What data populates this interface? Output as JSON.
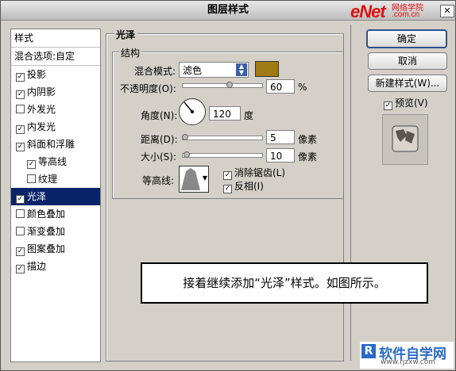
{
  "window": {
    "title": "图层样式"
  },
  "watermark": {
    "brand": "eNet",
    "cn": "网络学院",
    "url": ".com.cn"
  },
  "sidebar": {
    "header": "样式",
    "blend_options": "混合选项:自定",
    "items": [
      {
        "label": "投影",
        "checked": true
      },
      {
        "label": "内阴影",
        "checked": true
      },
      {
        "label": "外发光",
        "checked": false
      },
      {
        "label": "内发光",
        "checked": true
      },
      {
        "label": "斜面和浮雕",
        "checked": true
      },
      {
        "label": "等高线",
        "checked": true,
        "indent": true
      },
      {
        "label": "纹理",
        "checked": false,
        "indent": true
      },
      {
        "label": "光泽",
        "checked": true,
        "selected": true
      },
      {
        "label": "颜色叠加",
        "checked": false
      },
      {
        "label": "渐变叠加",
        "checked": false
      },
      {
        "label": "图案叠加",
        "checked": true
      },
      {
        "label": "描边",
        "checked": true
      }
    ]
  },
  "panel": {
    "group_title": "光泽",
    "structure_title": "结构",
    "blend_mode_label": "混合模式:",
    "blend_mode_value": "滤色",
    "swatch_color": "#a07a12",
    "opacity_label": "不透明度(O):",
    "opacity_value": "60",
    "opacity_unit": "%",
    "opacity_level": 0.6,
    "angle_label": "角度(N):",
    "angle_value": "120",
    "angle_unit": "度",
    "distance_label": "距离(D):",
    "distance_value": "5",
    "distance_unit": "像素",
    "size_label": "大小(S):",
    "size_value": "10",
    "size_unit": "像素",
    "contour_label": "等高线:",
    "antialias_label": "消除锯齿(L)",
    "antialias_checked": true,
    "invert_label": "反相(I)",
    "invert_checked": true
  },
  "buttons": {
    "ok": "确定",
    "cancel": "取消",
    "new_style": "新建样式(W)...",
    "preview_label": "预览(V)",
    "preview_checked": true
  },
  "hint": "接着继续添加“光泽”样式。如图所示。",
  "logo": {
    "text": "软件自学网",
    "url": "www.rjzxw.com"
  }
}
